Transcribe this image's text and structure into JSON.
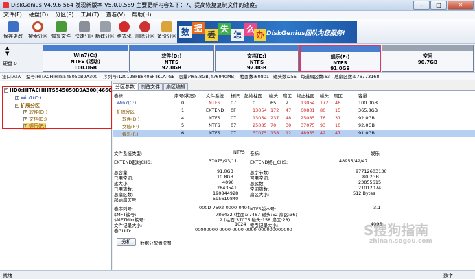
{
  "title": "DiskGenius V4.9.6.564  发现新版本 V5.0.0.589 主要更新内容如下：7、提高恢复复制文件的速度。",
  "menu": [
    "文件(F)",
    "硬盘(D)",
    "分区(P)",
    "工具(T)",
    "查看(V)",
    "帮助(H)"
  ],
  "toolbar": [
    {
      "label": "保存更改"
    },
    {
      "label": "搜索分区"
    },
    {
      "label": "恢复文件"
    },
    {
      "label": "快速分区"
    },
    {
      "label": "新建分区"
    },
    {
      "label": "格式化"
    },
    {
      "label": "删除分区"
    },
    {
      "label": "备份分区"
    }
  ],
  "banner": {
    "chars": [
      "数",
      "据",
      "丢",
      "失",
      "怎",
      "么",
      "办"
    ],
    "slogan": "DiskGenius团队为您服务!"
  },
  "disk_side": {
    "disk_label": "硬盘 0"
  },
  "partitions": [
    {
      "name": "Win7(C:)",
      "fs": "NTFS (活动)",
      "size": "100.0GB"
    },
    {
      "name": "软件(D:)",
      "fs": "NTFS",
      "size": "92.0GB"
    },
    {
      "name": "文档(E:)",
      "fs": "NTFS",
      "size": "92.0GB"
    },
    {
      "name": "娱乐(F:)",
      "fs": "NTFS",
      "size": "91.0GB"
    },
    {
      "name": "空闲",
      "fs": "",
      "size": "90.7GB"
    }
  ],
  "infoline": [
    "接口:ATA",
    "型号:HITACHIHTS545050B9A300",
    "序列号:120128FB8406FTKLATGE",
    "容量:465.8GB(476940MB)",
    "柱面数:60801",
    "磁头数:255",
    "每道扇区数:63",
    "总扇区数:976773168"
  ],
  "tree": {
    "disk": "HD0:HITACHIHTS545050B9A300(466GB",
    "items": [
      "Win7(C:)",
      "扩展分区",
      "软件(D:)",
      "文档(E:)",
      "娱乐(F:)"
    ]
  },
  "tabs": [
    "分区参数",
    "浏览文件",
    "扇区编辑"
  ],
  "table": {
    "headers": [
      "卷标",
      "序号(状态)",
      "文件系统",
      "标识",
      "起始柱面",
      "磁头",
      "扇区",
      "终止柱面",
      "磁头",
      "扇区",
      "容量"
    ],
    "rows": [
      [
        "Win7(C:)",
        "0",
        "NTFS",
        "07",
        "0",
        "65",
        "2",
        "13054",
        "172",
        "46",
        "100.0GB"
      ],
      [
        "扩展分区",
        "1",
        "EXTEND",
        "0F",
        "13054",
        "172",
        "47",
        "60801",
        "80",
        "15",
        "365.8GB"
      ],
      [
        "软件(D:)",
        "4",
        "NTFS",
        "07",
        "13054",
        "237",
        "48",
        "25085",
        "76",
        "31",
        "92.0GB"
      ],
      [
        "文档(E:)",
        "5",
        "NTFS",
        "07",
        "25085",
        "70",
        "30",
        "37075",
        "93",
        "10",
        "92.0GB"
      ],
      [
        "娱乐(F:)",
        "6",
        "NTFS",
        "07",
        "37075",
        "158",
        "12",
        "48955",
        "42",
        "47",
        "91.0GB"
      ]
    ]
  },
  "details": {
    "fs_type_label": "文件系统类型:",
    "fs_type": "NTFS",
    "vol_label_label": "卷标:",
    "vol_label": "娱乐",
    "ext_start_label": "EXTEND起始CHS:",
    "ext_start": "37075/93/11",
    "ext_end_label": "EXTEND终止CHS:",
    "ext_end": "48955/42/47",
    "left": [
      [
        "总容量:",
        "91.0GB"
      ],
      [
        "已用空间:",
        "10.8GB"
      ],
      [
        "簇大小:",
        "4096"
      ],
      [
        "已用簇数:",
        "2843541"
      ],
      [
        "总扇区数:",
        "190844928"
      ],
      [
        "起始扇区号:",
        "595619840"
      ]
    ],
    "right": [
      [
        "总字节数:",
        "97712603136"
      ],
      [
        "可用空间:",
        "80.2GB"
      ],
      [
        "总簇数:",
        "23855615"
      ],
      [
        "空闲簇数:",
        "21012074"
      ],
      [
        "扇区大小:",
        "512 Bytes"
      ]
    ],
    "serial_label": "卷序列号:",
    "serial": "000D-7592-0000-0404",
    "ntfs_ver_label": "NTFS版本号:",
    "ntfs_ver": "3.1",
    "mft_label": "$MFT簇号:",
    "mft": "786432 (柱面:37467 磁头:52 扇区:36)",
    "mftmirr_label": "$MFTMirr簇号:",
    "mftmirr": "2 (柱面:37075 磁头:158 扇区:28)",
    "rec_label": "文件记录大小:",
    "rec": "1024",
    "idx_label": "索引记录大小:",
    "idx": "4096",
    "guid_label": "卷GUID:",
    "guid": "00000000-0000-0000-0000-000000000000",
    "analyze_button": "分析",
    "analyze_label": "数据分配情况图:"
  },
  "status": {
    "left": "就绪",
    "right": "数字"
  },
  "watermark": {
    "big": "S搜狗指南",
    "small": "zhinan.sogou.com"
  },
  "colors": {
    "accent": "#4a7fd0",
    "selected_partition": "#d43a6a",
    "highlight_box": "#e02020"
  }
}
